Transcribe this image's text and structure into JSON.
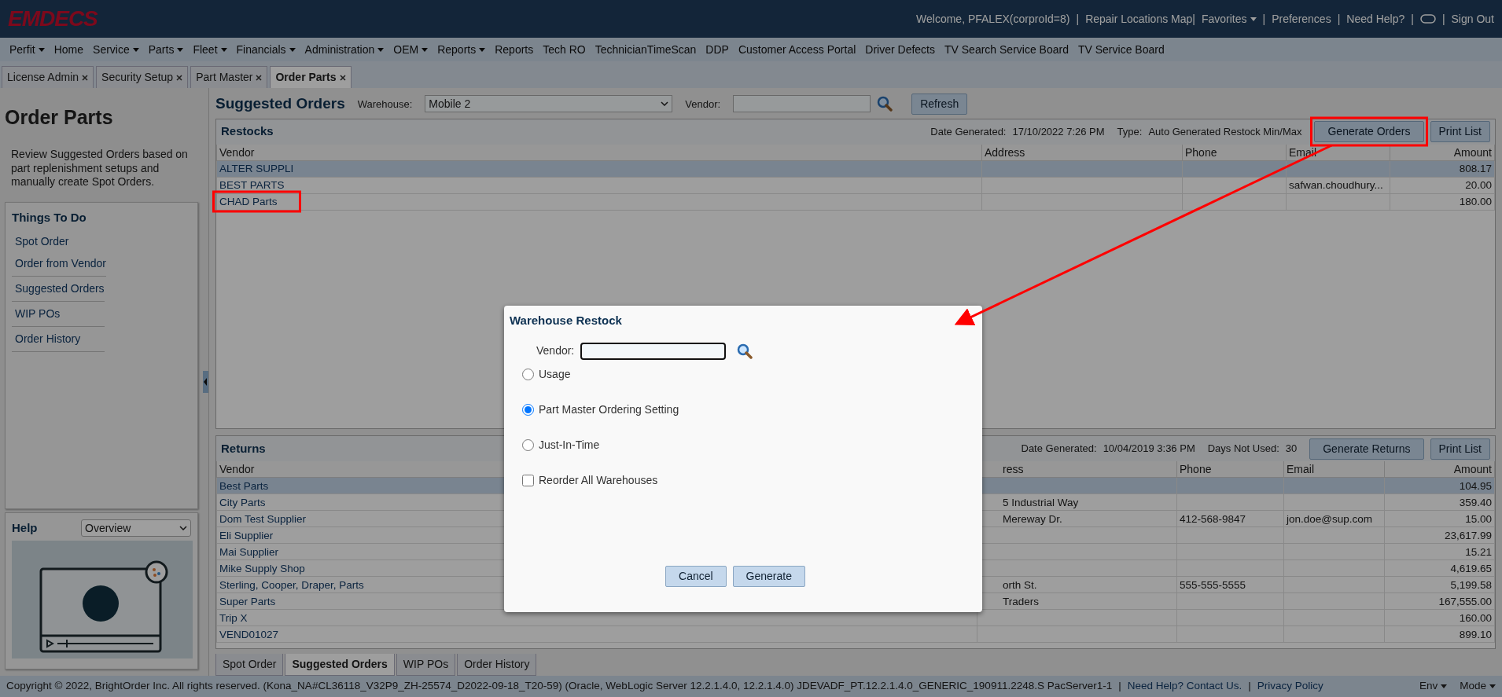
{
  "header": {
    "logo": "EMDECS",
    "links": [
      {
        "kind": "text",
        "text": "Welcome, PFALEX(corproId=8)"
      },
      {
        "kind": "sep",
        "text": "|"
      },
      {
        "kind": "link",
        "text": "Repair Locations Map|"
      },
      {
        "kind": "menu",
        "text": "Favorites"
      },
      {
        "kind": "sep",
        "text": "|"
      },
      {
        "kind": "link",
        "text": "Preferences"
      },
      {
        "kind": "sep",
        "text": "|"
      },
      {
        "kind": "link",
        "text": "Need Help?"
      },
      {
        "kind": "sep",
        "text": "|"
      },
      {
        "kind": "toggle"
      },
      {
        "kind": "sep",
        "text": "|"
      },
      {
        "kind": "link",
        "text": "Sign Out"
      }
    ]
  },
  "menu": [
    {
      "label": "Perfit",
      "dropdown": true
    },
    {
      "label": "Home",
      "dropdown": false
    },
    {
      "label": "Service",
      "dropdown": true
    },
    {
      "label": "Parts",
      "dropdown": true
    },
    {
      "label": "Fleet",
      "dropdown": true
    },
    {
      "label": "Financials",
      "dropdown": true
    },
    {
      "label": "Administration",
      "dropdown": true
    },
    {
      "label": "OEM",
      "dropdown": true
    },
    {
      "label": "Reports",
      "dropdown": true
    },
    {
      "label": "Reports",
      "dropdown": false
    },
    {
      "label": "Tech RO",
      "dropdown": false
    },
    {
      "label": "TechnicianTimeScan",
      "dropdown": false
    },
    {
      "label": "DDP",
      "dropdown": false
    },
    {
      "label": "Customer Access Portal",
      "dropdown": false
    },
    {
      "label": "Driver Defects",
      "dropdown": false
    },
    {
      "label": "TV Search Service Board",
      "dropdown": false
    },
    {
      "label": "TV Service Board",
      "dropdown": false
    }
  ],
  "tabs": [
    {
      "label": "License Admin",
      "selected": false
    },
    {
      "label": "Security Setup",
      "selected": false
    },
    {
      "label": "Part Master",
      "selected": false
    },
    {
      "label": "Order Parts",
      "selected": true
    }
  ],
  "sidebar": {
    "title": "Order Parts",
    "description": "Review Suggested Orders based on part replenishment setups and manually create Spot Orders.",
    "things_to_do": {
      "title": "Things To Do",
      "items": [
        "Spot Order",
        "Order from Vendor",
        "Suggested Orders",
        "WIP POs",
        "Order History"
      ]
    },
    "help": {
      "title": "Help",
      "select": "Overview"
    }
  },
  "main": {
    "title": "Suggested Orders",
    "warehouse_label": "Warehouse:",
    "warehouse": "Mobile 2",
    "vendor_label": "Vendor:",
    "refresh": "Refresh",
    "restocks": {
      "title": "Restocks",
      "meta": [
        {
          "label": "Date Generated:",
          "value": "17/10/2022 7:26 PM"
        },
        {
          "label": "Type:",
          "value": "Auto Generated Restock Min/Max"
        }
      ],
      "buttons": [
        "Generate Orders",
        "Print List"
      ],
      "columns": [
        "Vendor",
        "Address",
        "Phone",
        "Email",
        "Amount"
      ],
      "rows": [
        {
          "selected": true,
          "cells": [
            "ALTER SUPPLI",
            "",
            "",
            "",
            "808.17"
          ]
        },
        {
          "selected": false,
          "cells": [
            "BEST PARTS",
            "",
            "",
            "safwan.choudhury...",
            "20.00"
          ]
        },
        {
          "selected": false,
          "cells": [
            "CHAD Parts",
            "",
            "",
            "",
            "180.00"
          ]
        }
      ]
    },
    "returns": {
      "title": "Returns",
      "meta": [
        {
          "label": "Date Generated:",
          "value": "10/04/2019 3:36 PM"
        },
        {
          "label": "Days Not Used:",
          "value": "30"
        }
      ],
      "buttons": [
        "Generate Returns",
        "Print List"
      ],
      "columns": [
        "Vendor",
        "ress",
        "Phone",
        "Email",
        "Amount"
      ],
      "rows": [
        {
          "selected": true,
          "cells": [
            "Best Parts",
            "",
            "",
            "",
            "104.95"
          ]
        },
        {
          "selected": false,
          "cells": [
            "City Parts",
            "5 Industrial Way",
            "",
            "",
            "359.40"
          ]
        },
        {
          "selected": false,
          "cells": [
            "Dom Test Supplier",
            "Mereway Dr.",
            "412-568-9847",
            "jon.doe@sup.com",
            "15.00"
          ]
        },
        {
          "selected": false,
          "cells": [
            "Eli Supplier",
            "",
            "",
            "",
            "23,617.99"
          ]
        },
        {
          "selected": false,
          "cells": [
            "Mai Supplier",
            "",
            "",
            "",
            "15.21"
          ]
        },
        {
          "selected": false,
          "cells": [
            "Mike Supply Shop",
            "",
            "",
            "",
            "4,619.65"
          ]
        },
        {
          "selected": false,
          "cells": [
            "Sterling, Cooper, Draper, Parts",
            "orth St.",
            "555-555-5555",
            "",
            "5,199.58"
          ]
        },
        {
          "selected": false,
          "cells": [
            "Super Parts",
            "Traders",
            "",
            "",
            "167,555.00"
          ]
        },
        {
          "selected": false,
          "cells": [
            "Trip X",
            "",
            "",
            "",
            "160.00"
          ]
        },
        {
          "selected": false,
          "cells": [
            "VEND01027",
            "",
            "",
            "",
            "899.10"
          ]
        }
      ]
    }
  },
  "bottom_tabs": [
    {
      "label": "Spot Order",
      "selected": false
    },
    {
      "label": "Suggested Orders",
      "selected": true
    },
    {
      "label": "WIP POs",
      "selected": false
    },
    {
      "label": "Order History",
      "selected": false
    }
  ],
  "footer": {
    "copyright": "Copyright © 2022, BrightOrder Inc. All rights reserved.   (Kona_NA#CL36118_V32P9_ZH-25574_D2022-09-18_T20-59) (Oracle, WebLogic Server 12.2.1.4.0, 12.2.1.4.0) JDEVADF_PT.12.2.1.4.0_GENERIC_190911.2248.S PacServer1-1",
    "sep1": "|",
    "help_link": "Need Help? Contact Us.",
    "sep2": "|",
    "privacy": "Privacy Policy",
    "menus": [
      "Env",
      "Mode"
    ]
  },
  "dialog": {
    "title": "Warehouse Restock",
    "vendor_label": "Vendor:",
    "options": [
      {
        "kind": "radio",
        "label": "Usage",
        "checked": false
      },
      {
        "kind": "radio",
        "label": "Part Master Ordering Setting",
        "checked": true
      },
      {
        "kind": "radio",
        "label": "Just-In-Time",
        "checked": false
      },
      {
        "kind": "checkbox",
        "label": "Reorder All Warehouses",
        "checked": false
      }
    ],
    "buttons": [
      "Cancel",
      "Generate"
    ]
  }
}
